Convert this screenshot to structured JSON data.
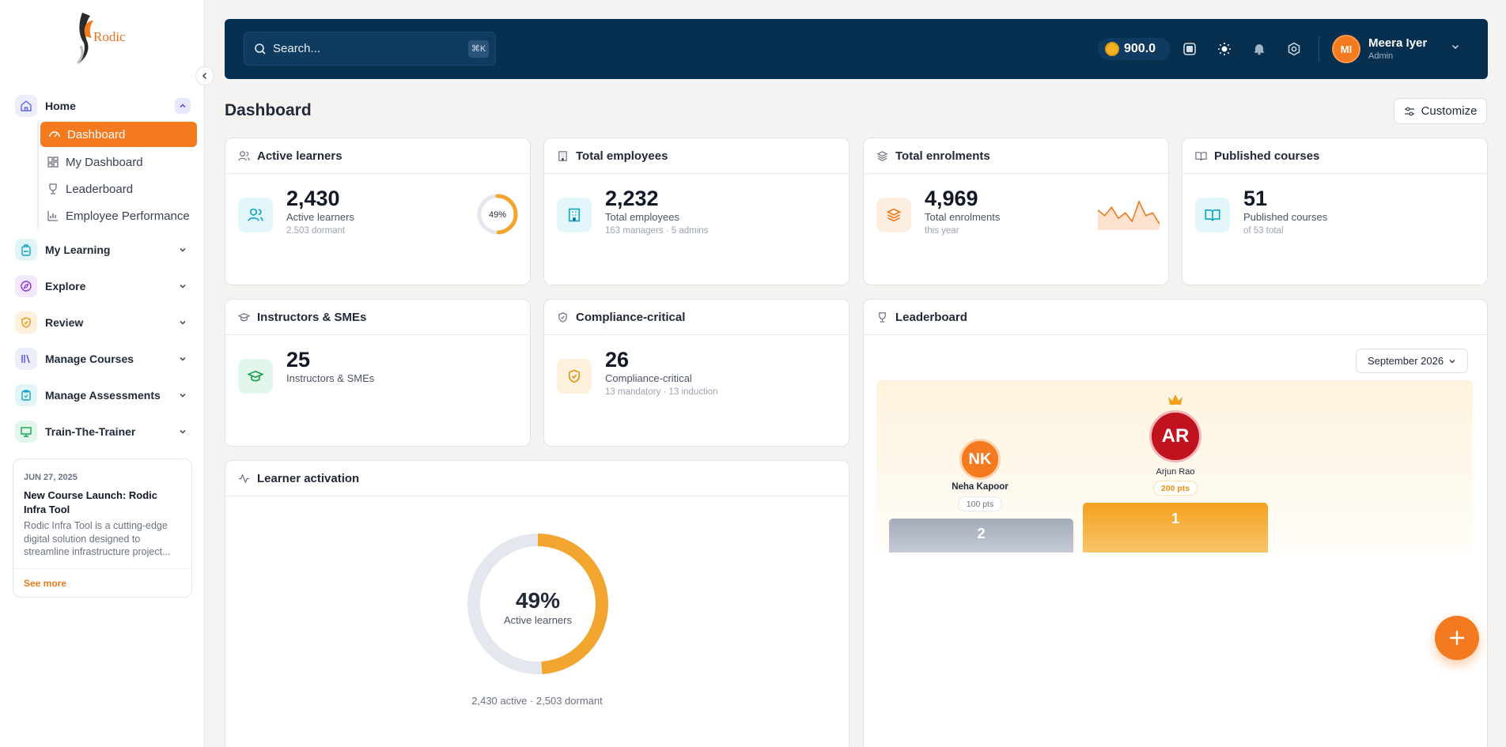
{
  "brand": {
    "logo_text": "Rodic"
  },
  "sidebar": {
    "home": {
      "label": "Home"
    },
    "sub_items": [
      {
        "label": "Dashboard"
      },
      {
        "label": "My Dashboard"
      },
      {
        "label": "Leaderboard"
      },
      {
        "label": "Employee Performance"
      }
    ],
    "groups": [
      {
        "label": "My Learning"
      },
      {
        "label": "Explore"
      },
      {
        "label": "Review"
      },
      {
        "label": "Manage Courses"
      },
      {
        "label": "Manage Assessments"
      },
      {
        "label": "Train-The-Trainer"
      }
    ],
    "news": {
      "date": "JUN 27, 2025",
      "title": "New Course Launch: Rodic Infra Tool",
      "body": "Rodic Infra Tool is a cutting-edge digital solution designed to streamline infrastructure project...",
      "see_more": "See more"
    }
  },
  "topbar": {
    "search_placeholder": "Search...",
    "shortcut": "⌘K",
    "coins": "900.0",
    "user": {
      "initials": "MI",
      "name": "Meera Iyer",
      "role": "Admin"
    }
  },
  "page": {
    "title": "Dashboard",
    "customize_label": "Customize"
  },
  "cards": {
    "active_learners": {
      "title": "Active learners",
      "value": "2,430",
      "label": "Active learners",
      "sub": "2,503 dormant",
      "percent_label": "49%",
      "percent": 49
    },
    "total_employees": {
      "title": "Total employees",
      "value": "2,232",
      "label": "Total employees",
      "sub": "163 managers · 5 admins"
    },
    "total_enrolments": {
      "title": "Total enrolments",
      "value": "4,969",
      "label": "Total enrolments",
      "sub": "this year",
      "spark": [
        6,
        4,
        7,
        3,
        5,
        2,
        9,
        4,
        5,
        1
      ]
    },
    "published_courses": {
      "title": "Published courses",
      "value": "51",
      "label": "Published courses",
      "sub": "of 53 total"
    },
    "instructors": {
      "title": "Instructors & SMEs",
      "value": "25",
      "label": "Instructors & SMEs"
    },
    "compliance": {
      "title": "Compliance-critical",
      "value": "26",
      "label": "Compliance-critical",
      "sub": "13 mandatory · 13 induction"
    },
    "activation": {
      "title": "Learner activation",
      "percent_label": "49%",
      "percent": 49,
      "center_label": "Active learners",
      "footer": "2,430 active · 2,503 dormant"
    },
    "leaderboard": {
      "title": "Leaderboard",
      "month": "September 2026",
      "first": {
        "initials": "AR",
        "name": "Arjun Rao",
        "points": "200 pts",
        "rank": "1"
      },
      "second": {
        "initials": "NK",
        "name": "Neha Kapoor",
        "points": "100 pts",
        "rank": "2"
      }
    }
  },
  "colors": {
    "accent": "#f47a1f",
    "navy": "#062f50",
    "ring": "#f2a630",
    "ring_track": "#e5e7ee"
  }
}
